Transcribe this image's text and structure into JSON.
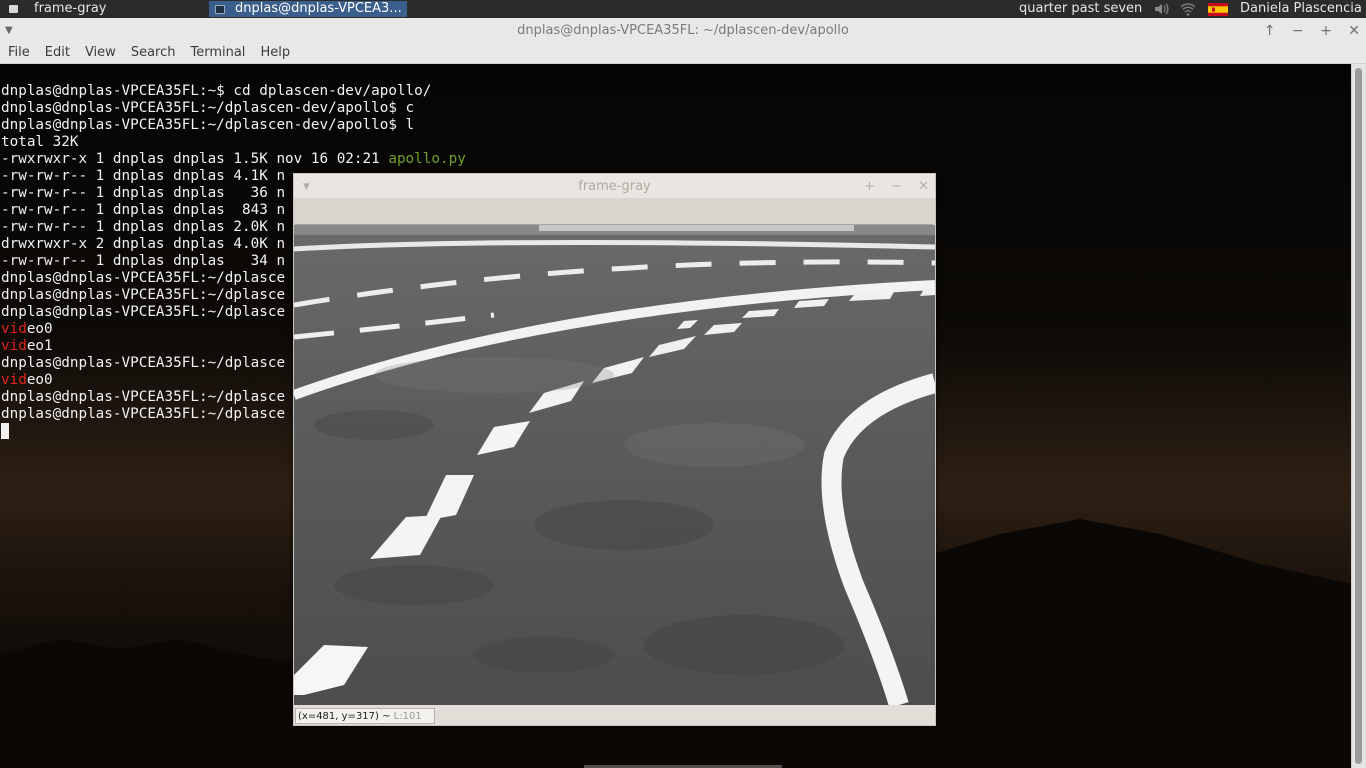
{
  "taskbar": {
    "tasks": [
      {
        "label": "frame-gray",
        "active": false
      },
      {
        "label": "dnplas@dnplas-VPCEA3...",
        "active": true
      }
    ],
    "clock": "quarter past seven",
    "user": "Daniela Plascencia",
    "icons": [
      "volume-icon",
      "wifi-icon",
      "spain-flag-icon"
    ]
  },
  "terminal": {
    "title": "dnplas@dnplas-VPCEA35FL: ~/dplascen-dev/apollo",
    "menu": [
      "File",
      "Edit",
      "View",
      "Search",
      "Terminal",
      "Help"
    ],
    "lines": [
      "dnplas@dnplas-VPCEA35FL:~$ cd dplascen-dev/apollo/",
      "dnplas@dnplas-VPCEA35FL:~/dplascen-dev/apollo$ c",
      "",
      "dnplas@dnplas-VPCEA35FL:~/dplascen-dev/apollo$ l",
      "total 32K",
      "-rwxrwxr-x 1 dnplas dnplas 1.5K nov 16 02:21 ",
      "-rw-rw-r-- 1 dnplas dnplas 4.1K n",
      "-rw-rw-r-- 1 dnplas dnplas   36 n",
      "-rw-rw-r-- 1 dnplas dnplas  843 n",
      "-rw-rw-r-- 1 dnplas dnplas 2.0K n",
      "drwxrwxr-x 2 dnplas dnplas 4.0K n",
      "-rw-rw-r-- 1 dnplas dnplas   34 n",
      "dnplas@dnplas-VPCEA35FL:~/dplasce",
      "dnplas@dnplas-VPCEA35FL:~/dplasce",
      "dnplas@dnplas-VPCEA35FL:~/dplasce",
      "eo0",
      "eo1",
      "dnplas@dnplas-VPCEA35FL:~/dplasce",
      "eo0",
      "dnplas@dnplas-VPCEA35FL:~/dplasce",
      "dnplas@dnplas-VPCEA35FL:~/dplasce"
    ],
    "apollo_file": "apollo.py",
    "vid_prefix": "vid"
  },
  "frame_window": {
    "title": "frame-gray",
    "status": "(x=481, y=317) ~ ",
    "status_value": "L:101"
  }
}
